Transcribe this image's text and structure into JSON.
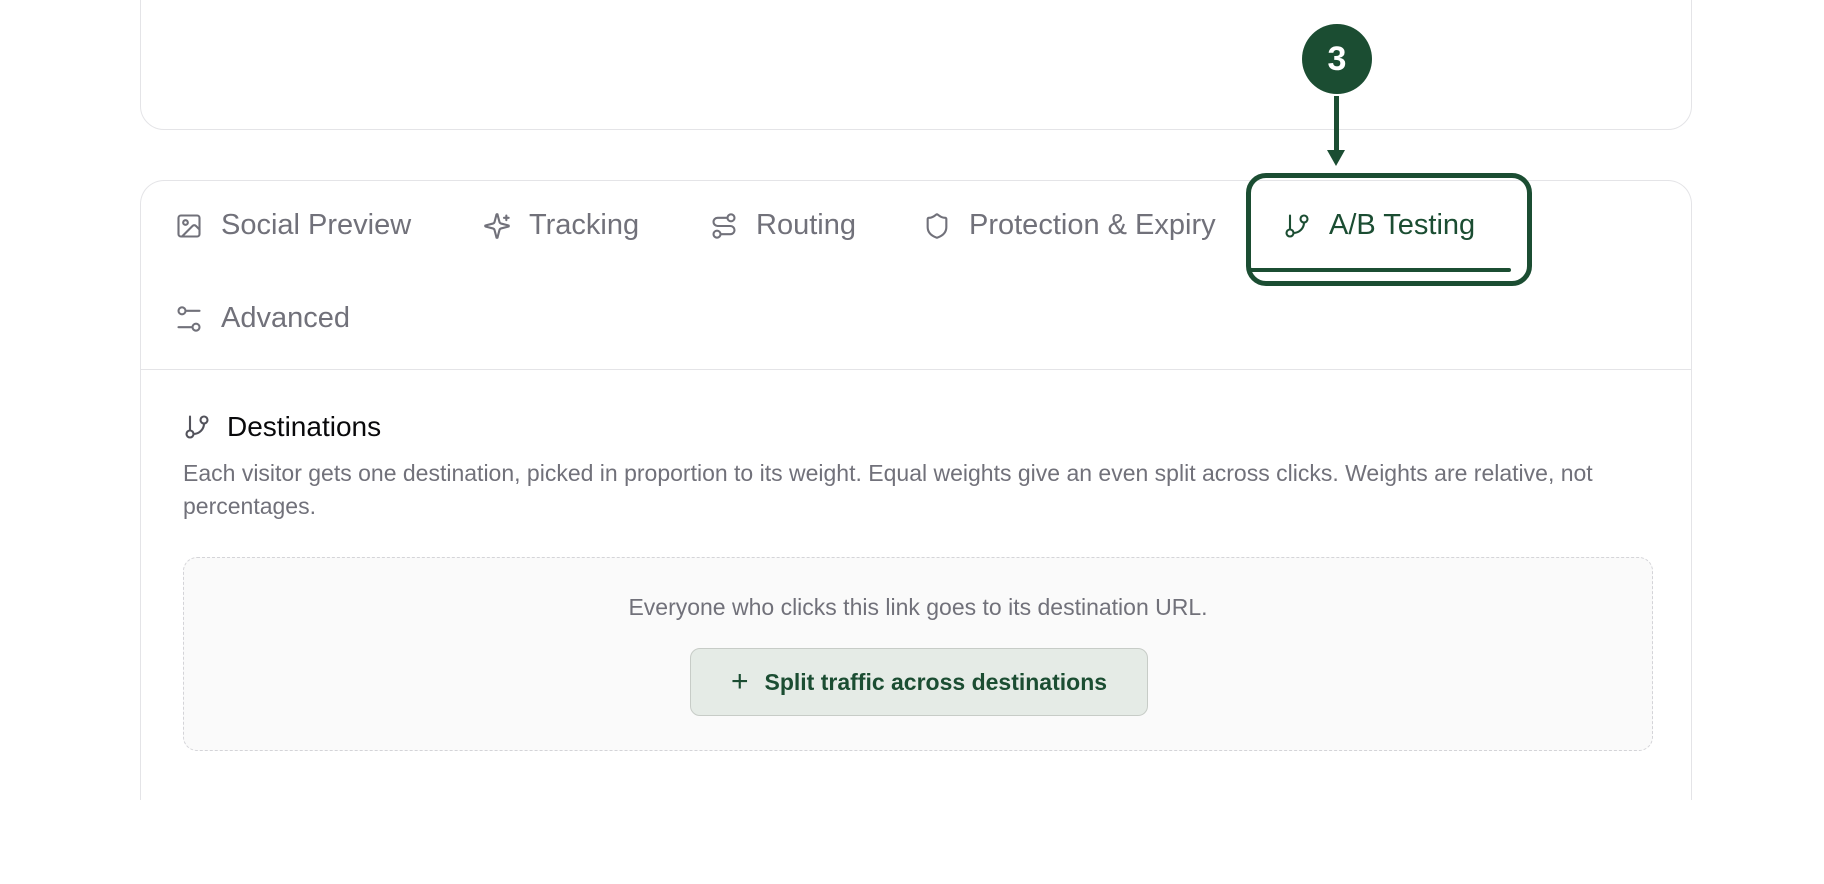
{
  "tabs": [
    {
      "label": "Social Preview",
      "icon": "image-icon"
    },
    {
      "label": "Tracking",
      "icon": "sparkles-icon"
    },
    {
      "label": "Routing",
      "icon": "route-icon"
    },
    {
      "label": "Protection & Expiry",
      "icon": "shield-icon"
    },
    {
      "label": "A/B Testing",
      "icon": "git-branch-icon",
      "active": true
    },
    {
      "label": "Advanced",
      "icon": "sliders-icon"
    }
  ],
  "section": {
    "title": "Destinations",
    "icon": "git-branch-icon",
    "description": "Each visitor gets one destination, picked in proportion to its weight. Equal weights give an even split across clicks. Weights are relative, not percentages."
  },
  "empty_state": {
    "message": "Everyone who clicks this link goes to its destination URL.",
    "button_label": "Split traffic across destinations",
    "button_icon": "plus-icon"
  },
  "annotation": {
    "step": "3"
  },
  "colors": {
    "accent": "#1b4d32",
    "muted_text": "#71717a",
    "border": "#e4e4e7",
    "button_bg": "#e5ebe6"
  }
}
